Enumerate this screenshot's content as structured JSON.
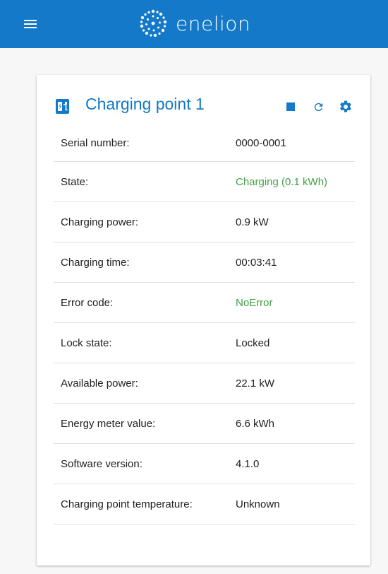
{
  "appbar": {
    "brand": "enelion",
    "menu_icon": "hamburger-menu-icon",
    "logo_icon": "enelion-logo-icon",
    "color": "#1479c8"
  },
  "card": {
    "title": "Charging point 1",
    "title_icon": "charging-station-icon",
    "actions": [
      {
        "icon": "stop-icon"
      },
      {
        "icon": "refresh-icon"
      },
      {
        "icon": "settings-gear-icon"
      }
    ],
    "accent_color": "#1479c8",
    "ok_color": "#43a047"
  },
  "details": [
    {
      "label": "Serial number:",
      "value": "0000-0001",
      "status": "normal"
    },
    {
      "label": "State:",
      "value": "Charging (0.1 kWh)",
      "status": "ok"
    },
    {
      "label": "Charging power:",
      "value": "0.9 kW",
      "status": "normal"
    },
    {
      "label": "Charging time:",
      "value": "00:03:41",
      "status": "normal"
    },
    {
      "label": "Error code:",
      "value": "NoError",
      "status": "ok"
    },
    {
      "label": "Lock state:",
      "value": "Locked",
      "status": "normal"
    },
    {
      "label": "Available power:",
      "value": "22.1 kW",
      "status": "normal"
    },
    {
      "label": "Energy meter value:",
      "value": "6.6 kWh",
      "status": "normal"
    },
    {
      "label": "Software version:",
      "value": "4.1.0",
      "status": "normal"
    },
    {
      "label": "Charging point temperature:",
      "value": "Unknown",
      "status": "normal"
    }
  ]
}
